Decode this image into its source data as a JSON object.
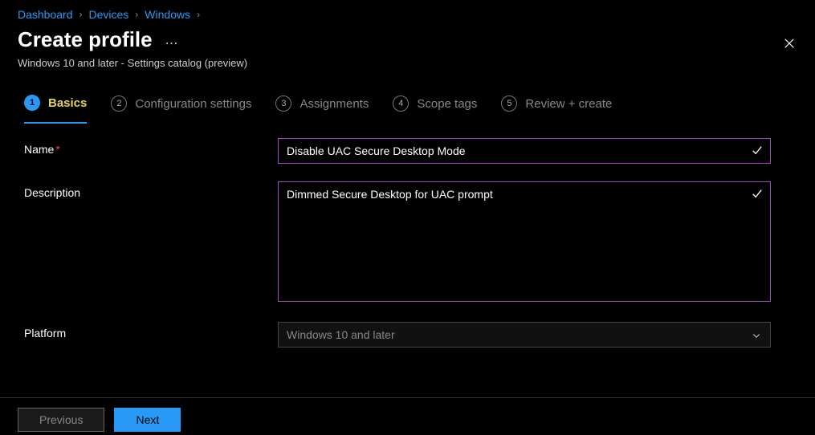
{
  "breadcrumb": {
    "items": [
      {
        "label": "Dashboard"
      },
      {
        "label": "Devices"
      },
      {
        "label": "Windows"
      }
    ]
  },
  "header": {
    "title": "Create profile",
    "subtitle": "Windows 10 and later - Settings catalog (preview)"
  },
  "wizard": {
    "steps": [
      {
        "num": "1",
        "label": "Basics",
        "active": true
      },
      {
        "num": "2",
        "label": "Configuration settings"
      },
      {
        "num": "3",
        "label": "Assignments"
      },
      {
        "num": "4",
        "label": "Scope tags"
      },
      {
        "num": "5",
        "label": "Review + create"
      }
    ]
  },
  "form": {
    "name_label": "Name",
    "name_value": "Disable UAC Secure Desktop Mode",
    "description_label": "Description",
    "description_value": "Dimmed Secure Desktop for UAC prompt",
    "platform_label": "Platform",
    "platform_value": "Windows 10 and later"
  },
  "footer": {
    "previous": "Previous",
    "next": "Next"
  }
}
